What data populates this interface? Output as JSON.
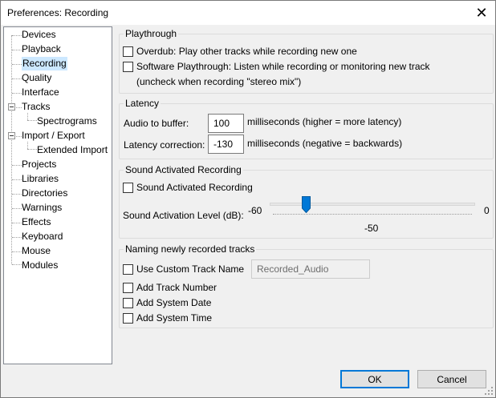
{
  "window": {
    "title": "Preferences: Recording"
  },
  "tree": {
    "items": [
      {
        "label": "Devices"
      },
      {
        "label": "Playback"
      },
      {
        "label": "Recording"
      },
      {
        "label": "Quality"
      },
      {
        "label": "Interface"
      },
      {
        "label": "Tracks"
      },
      {
        "label": "Spectrograms"
      },
      {
        "label": "Import / Export"
      },
      {
        "label": "Extended Import"
      },
      {
        "label": "Projects"
      },
      {
        "label": "Libraries"
      },
      {
        "label": "Directories"
      },
      {
        "label": "Warnings"
      },
      {
        "label": "Effects"
      },
      {
        "label": "Keyboard"
      },
      {
        "label": "Mouse"
      },
      {
        "label": "Modules"
      }
    ],
    "selected": "Recording"
  },
  "playthrough": {
    "title": "Playthrough",
    "overdub": "Overdub: Play other tracks while recording new one",
    "software": "Software Playthrough: Listen while recording or monitoring new track",
    "software_note": "(uncheck when recording \"stereo mix\")"
  },
  "latency": {
    "title": "Latency",
    "buffer_label": "Audio to buffer:",
    "buffer_value": "100",
    "buffer_unit": "milliseconds (higher = more latency)",
    "correction_label": "Latency correction:",
    "correction_value": "-130",
    "correction_unit": "milliseconds (negative = backwards)"
  },
  "sound_activated": {
    "title": "Sound Activated Recording",
    "checkbox": "Sound Activated Recording",
    "level_label": "Sound Activation Level (dB):",
    "min": "-60",
    "max": "0",
    "value": "-50",
    "level_db": -50
  },
  "naming": {
    "title": "Naming newly recorded tracks",
    "custom_name": "Use Custom Track Name",
    "custom_value": "Recorded_Audio",
    "track_number": "Add Track Number",
    "system_date": "Add System Date",
    "system_time": "Add System Time"
  },
  "buttons": {
    "ok": "OK",
    "cancel": "Cancel"
  },
  "colors": {
    "selection": "#cce8ff",
    "accent": "#0078d7"
  }
}
